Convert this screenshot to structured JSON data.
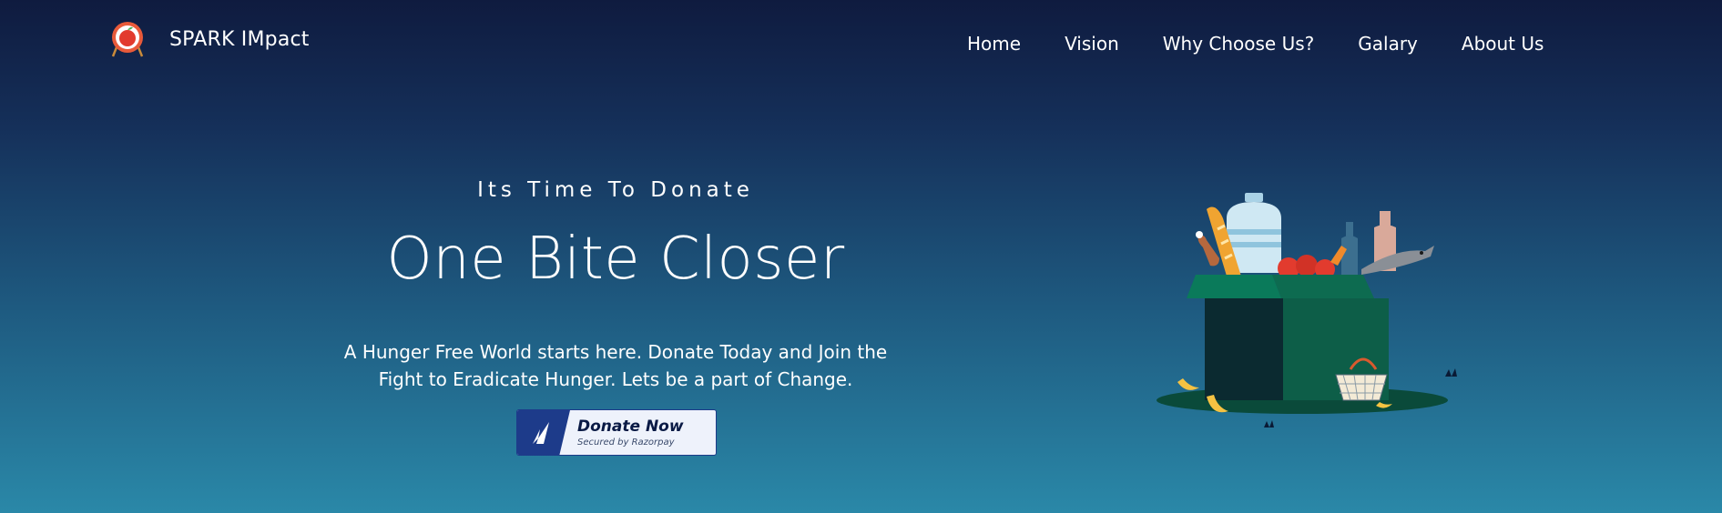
{
  "brand": {
    "name": "SPARK IMpact",
    "logo_icon": "apple-target-icon"
  },
  "nav": {
    "items": [
      "Home",
      "Vision",
      "Why Choose Us?",
      "Galary",
      "About Us"
    ]
  },
  "hero": {
    "eyebrow": "Its Time To Donate",
    "title": "One Bite Closer",
    "description": "A Hunger Free World starts here. Donate Today and Join the Fight to Eradicate Hunger. Lets be a part of Change.",
    "cta": {
      "label": "Donate Now",
      "sublabel": "Secured by Razorpay",
      "icon": "razorpay-icon"
    }
  },
  "illustration": {
    "name": "food-donation-box-illustration"
  },
  "colors": {
    "bg_top": "#0f1b3f",
    "bg_bottom": "#2a88a8",
    "button_accent": "#1d3b8a",
    "box_green": "#0d6b50"
  }
}
